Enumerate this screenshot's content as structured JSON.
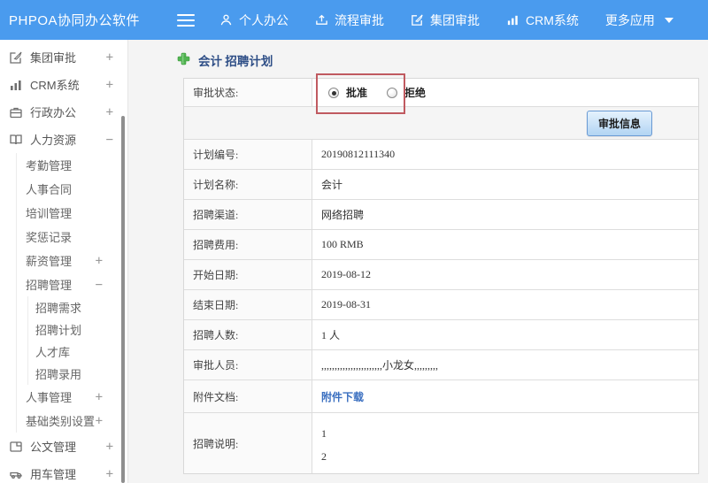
{
  "header": {
    "app_title": "PHPOA协同办公软件",
    "nav": [
      {
        "label": "个人办公",
        "icon": "user-icon"
      },
      {
        "label": "流程审批",
        "icon": "process-icon"
      },
      {
        "label": "集团审批",
        "icon": "edit-square-icon"
      },
      {
        "label": "CRM系统",
        "icon": "bar-chart-icon"
      },
      {
        "label": "更多应用",
        "icon": "caret-down-icon"
      }
    ]
  },
  "sidebar": {
    "items": [
      {
        "label": "集团审批",
        "icon": "edit-square-icon",
        "toggle": "+"
      },
      {
        "label": "CRM系统",
        "icon": "bar-chart-icon",
        "toggle": "+"
      },
      {
        "label": "行政办公",
        "icon": "briefcase-icon",
        "toggle": "+"
      },
      {
        "label": "人力资源",
        "icon": "book-icon",
        "toggle": "−",
        "children": [
          {
            "label": "考勤管理",
            "toggle": ""
          },
          {
            "label": "人事合同",
            "toggle": ""
          },
          {
            "label": "培训管理",
            "toggle": ""
          },
          {
            "label": "奖惩记录",
            "toggle": ""
          },
          {
            "label": "薪资管理",
            "toggle": "+"
          },
          {
            "label": "招聘管理",
            "toggle": "−",
            "children": [
              {
                "label": "招聘需求"
              },
              {
                "label": "招聘计划"
              },
              {
                "label": "人才库"
              },
              {
                "label": "招聘录用"
              }
            ]
          },
          {
            "label": "人事管理",
            "toggle": "+"
          },
          {
            "label": "基础类别设置",
            "toggle": "+"
          }
        ]
      },
      {
        "label": "公文管理",
        "icon": "document-icon",
        "toggle": "+"
      },
      {
        "label": "用车管理",
        "icon": "vehicle-icon",
        "toggle": "+"
      }
    ]
  },
  "main": {
    "page_title": "会计 招聘计划",
    "approval": {
      "label": "审批状态:",
      "options": [
        {
          "label": "批准",
          "selected": true
        },
        {
          "label": "拒绝",
          "selected": false
        }
      ],
      "button_label": "审批信息"
    },
    "fields": [
      {
        "label": "计划编号:",
        "value": "20190812111340"
      },
      {
        "label": "计划名称:",
        "value": "会计"
      },
      {
        "label": "招聘渠道:",
        "value": "网络招聘"
      },
      {
        "label": "招聘费用:",
        "value": "100 RMB"
      },
      {
        "label": "开始日期:",
        "value": "2019-08-12"
      },
      {
        "label": "结束日期:",
        "value": "2019-08-31"
      },
      {
        "label": "招聘人数:",
        "value": "1 人"
      },
      {
        "label": "审批人员:",
        "value": ",,,,,,,,,,,,,,,,,,,,,,,小龙女,,,,,,,,,"
      },
      {
        "label": "附件文档:",
        "value": "附件下载",
        "type": "link"
      },
      {
        "label": "招聘说明:",
        "type": "multiline",
        "lines": [
          "1",
          "2"
        ]
      }
    ]
  },
  "colors": {
    "header_blue": "#4a9bee",
    "title_navy": "#2e4e86",
    "link_blue": "#3a6fc0",
    "annotation_red": "#c05a60",
    "plus_green": "#52b552",
    "button_border": "#699ad4"
  }
}
